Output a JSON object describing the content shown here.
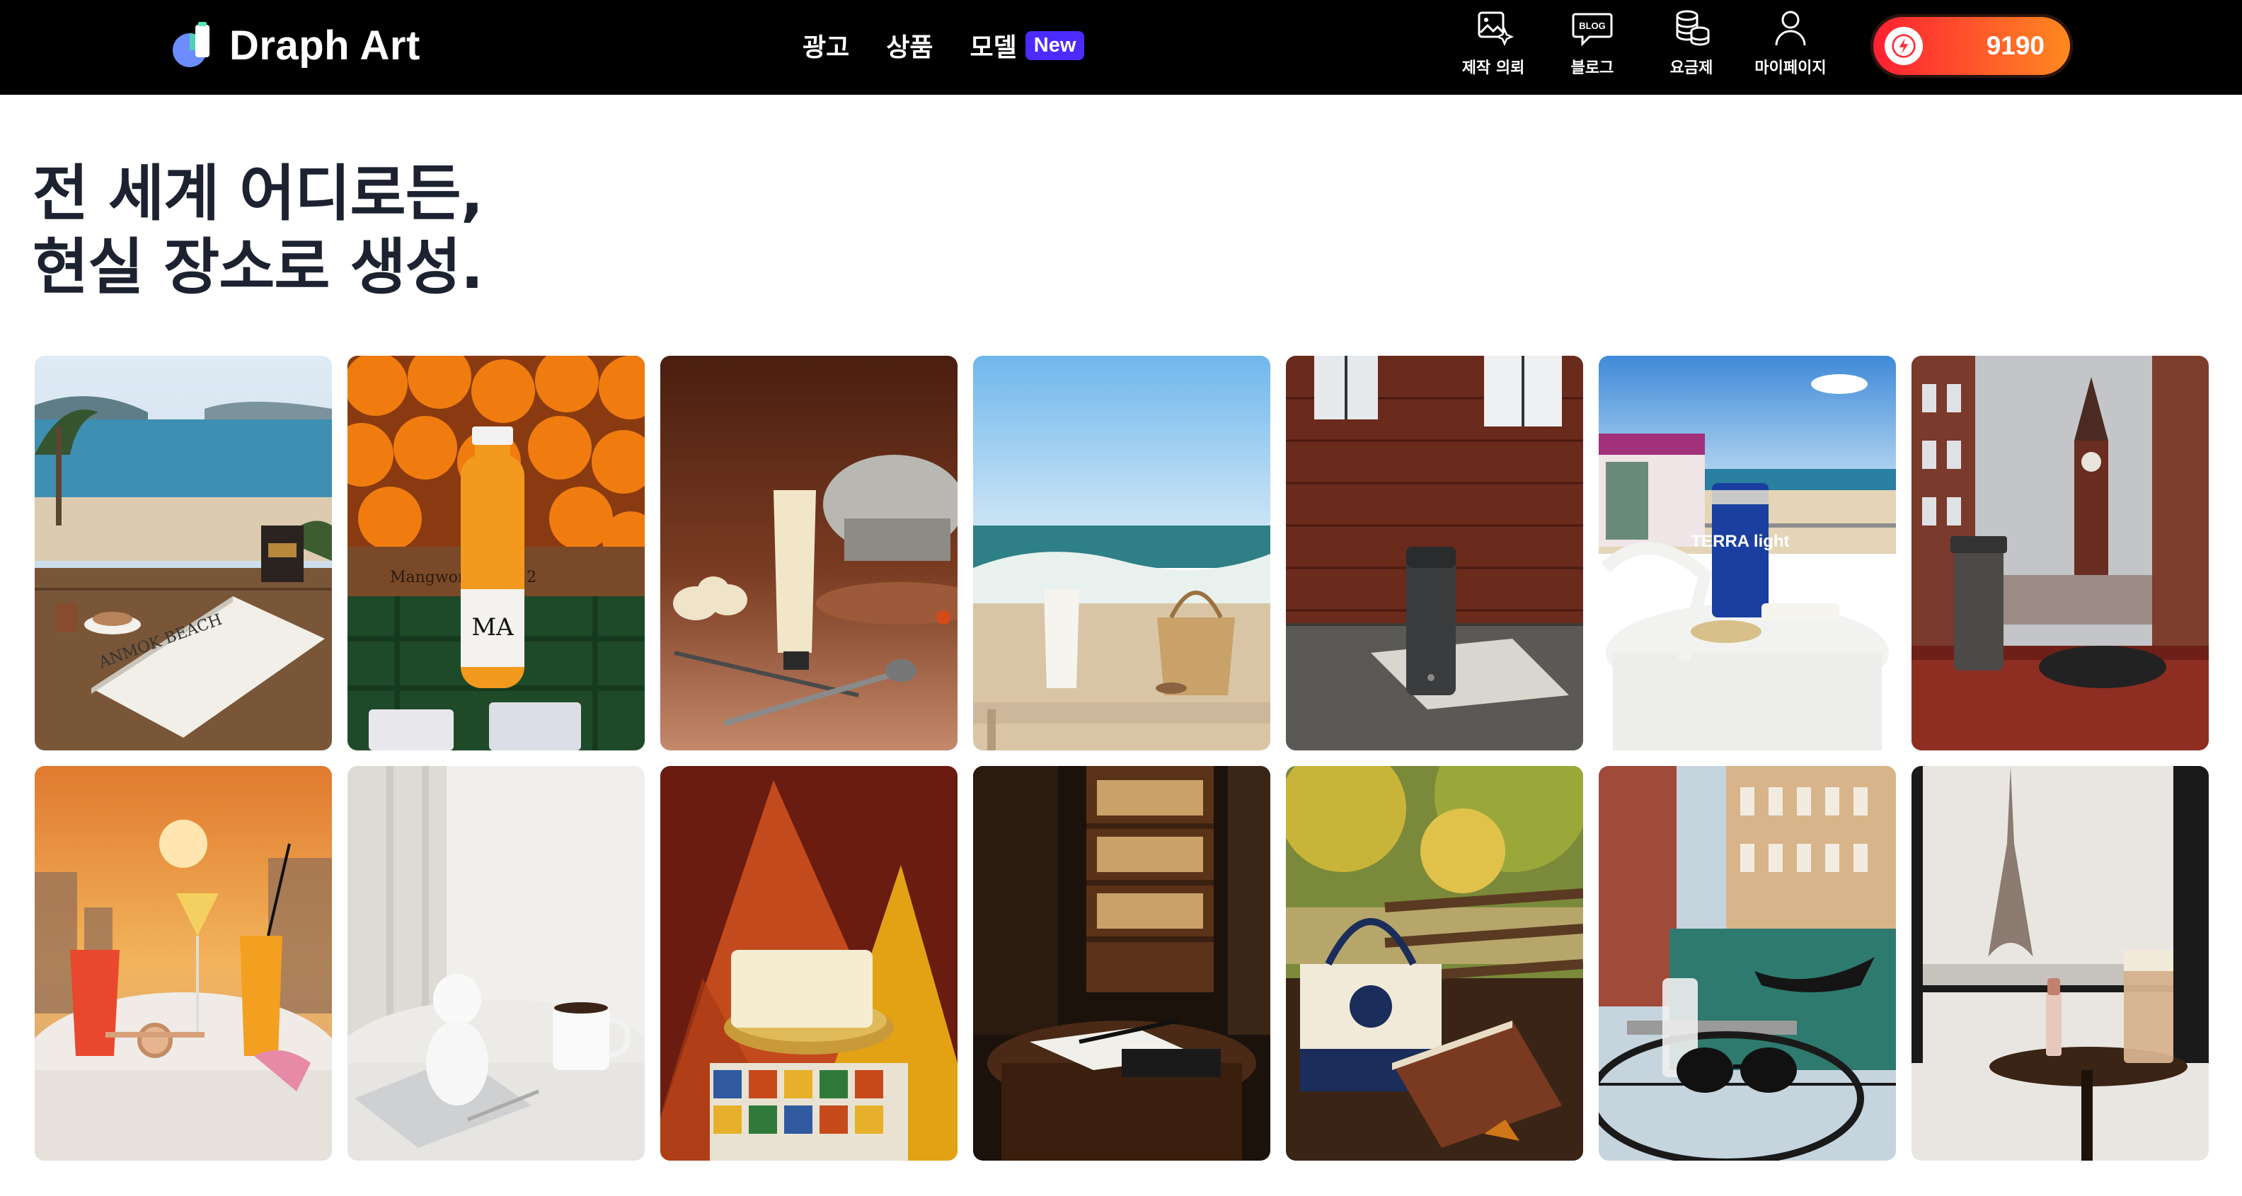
{
  "header": {
    "brand": "Draph Art",
    "nav": [
      {
        "label": "광고"
      },
      {
        "label": "상품"
      },
      {
        "label": "모델",
        "badge": "New"
      }
    ],
    "right_nav": [
      {
        "label": "제작 의뢰",
        "icon": "image-request-icon"
      },
      {
        "label": "블로그",
        "icon": "blog-icon",
        "icon_text": "BLOG"
      },
      {
        "label": "요금제",
        "icon": "coins-icon"
      },
      {
        "label": "마이페이지",
        "icon": "user-icon"
      }
    ],
    "credits": "9190",
    "credit_icon": "lightning-bolt-icon"
  },
  "headline": {
    "line1": "전 세계 어디로든,",
    "line2": "현실 장소로 생성."
  },
  "gallery": [
    {
      "name": "beach-terrace-book",
      "label": "ANMOK BEACH"
    },
    {
      "name": "oranges-juice-bottle",
      "label": "MA",
      "crate_text": "Mangwon ARM 12"
    },
    {
      "name": "dumplings-cream-tube"
    },
    {
      "name": "beach-sunscreen-bag"
    },
    {
      "name": "brick-window-tumbler"
    },
    {
      "name": "beach-balcony-beer-can",
      "label": "TERRA light"
    },
    {
      "name": "clocktower-tumbler-gloves"
    },
    {
      "name": "sunset-cocktails-watch"
    },
    {
      "name": "white-table-mug"
    },
    {
      "name": "spice-pile-soap"
    },
    {
      "name": "library-notebook-pen"
    },
    {
      "name": "park-bench-tote-book"
    },
    {
      "name": "venice-canal-sunglasses"
    },
    {
      "name": "eiffel-cafe-lipstick"
    }
  ],
  "colors": {
    "topbar": "#000000",
    "accent_new": "#4b2bff",
    "credit_gradient_start": "#ff1e33",
    "credit_gradient_end": "#ff8a1f"
  }
}
